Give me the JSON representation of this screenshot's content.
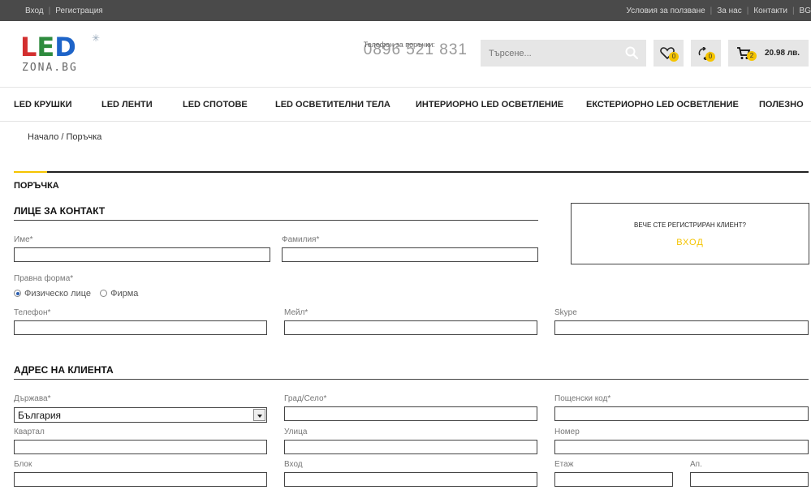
{
  "topbar": {
    "login": "Вход",
    "register": "Регистрация",
    "terms": "Условия за ползване",
    "about": "За нас",
    "contacts": "Контакти",
    "lang": "BG"
  },
  "header": {
    "logo_text": "LED",
    "logo_sub": "ZONA.BG",
    "phone_label": "Телефон за поръчки:",
    "phone_number": "0896 521 831",
    "search_placeholder": "Търсене...",
    "wishlist_count": "0",
    "compare_count": "0",
    "cart_count": "2",
    "cart_total": "20.98 лв."
  },
  "nav": [
    "LED КРУШКИ",
    "LED ЛЕНТИ",
    "LED СПОТОВЕ",
    "LED ОСВЕТИТЕЛНИ ТЕЛА",
    "ИНТЕРИОРНО LED ОСВЕТЛЕНИЕ",
    "ЕКСТЕРИОРНО LED ОСВЕТЛЕНИЕ",
    "ПОЛЕЗНО"
  ],
  "breadcrumb": "Начало / Поръчка",
  "page_title": "ПОРЪЧКА",
  "contact": {
    "title": "ЛИЦЕ ЗА КОНТАКТ",
    "first_name_label": "Име*",
    "last_name_label": "Фамилия*",
    "legal_form_label": "Правна форма*",
    "legal_form_options": [
      "Физическо лице",
      "Фирма"
    ],
    "phone_label": "Телефон*",
    "email_label": "Мейл*",
    "skype_label": "Skype"
  },
  "login_box": {
    "question": "ВЕЧЕ СТЕ РЕГИСТРИРАН КЛИЕНТ?",
    "button": "ВХОД"
  },
  "address": {
    "title": "АДРЕС НА КЛИЕНТА",
    "country_label": "Държава*",
    "country_value": "България",
    "city_label": "Град/Село*",
    "postcode_label": "Пощенски код*",
    "district_label": "Квартал",
    "street_label": "Улица",
    "number_label": "Номер",
    "block_label": "Блок",
    "entrance_label": "Вход",
    "floor_label": "Етаж",
    "apartment_label": "Ап."
  },
  "colors": {
    "accent": "#f5c400",
    "topbar": "#4a4a4a",
    "logo_red": "#d32f2f",
    "logo_green": "#2e8b3e",
    "logo_blue": "#1e64c8"
  }
}
